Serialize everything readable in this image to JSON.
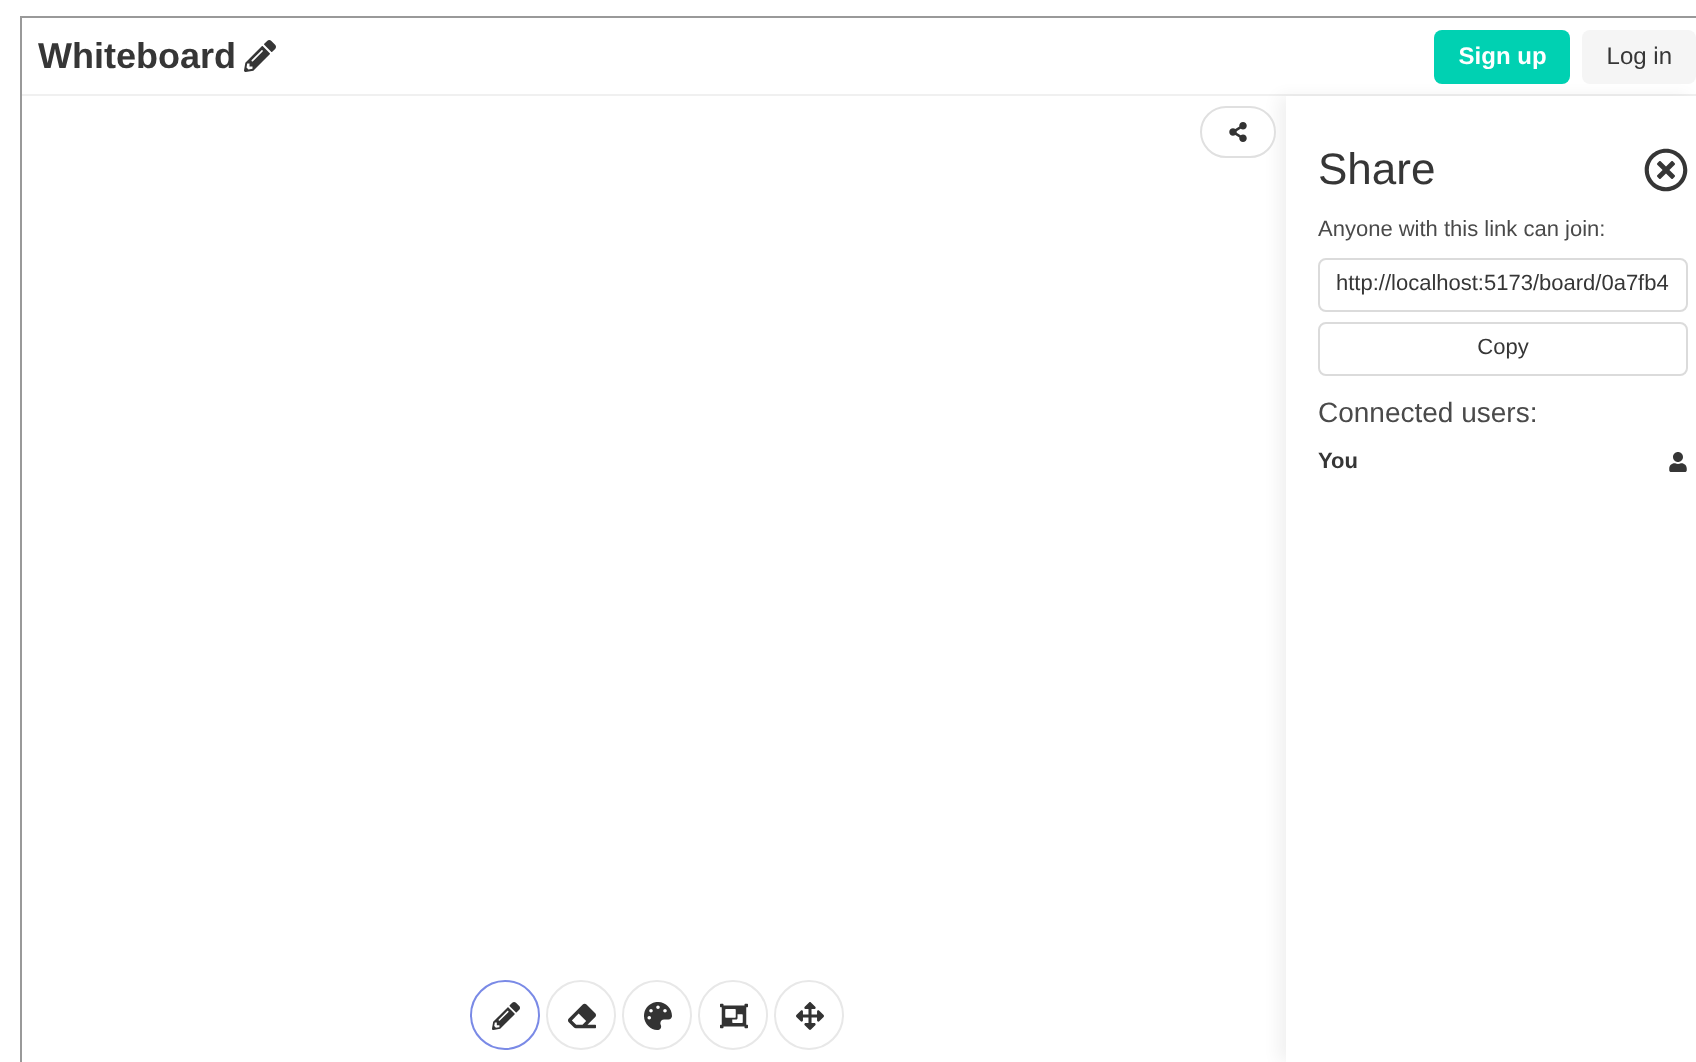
{
  "header": {
    "title": "Whiteboard",
    "buttons": [
      {
        "label": "Sign up",
        "kind": "primary"
      },
      {
        "label": "Log in",
        "kind": "secondary"
      }
    ]
  },
  "share_panel": {
    "title": "Share",
    "link_label": "Anyone with this link can join:",
    "link_value": "http://localhost:5173/board/0a7fb4",
    "copy_button": "Copy",
    "users_heading": "Connected users:",
    "users": [
      {
        "name": "You"
      }
    ]
  },
  "toolbar": [
    {
      "kind": "pencil",
      "selected": true
    },
    {
      "kind": "eraser",
      "selected": false
    },
    {
      "kind": "palette",
      "selected": false
    },
    {
      "kind": "frame",
      "selected": false
    },
    {
      "kind": "move",
      "selected": false
    }
  ]
}
